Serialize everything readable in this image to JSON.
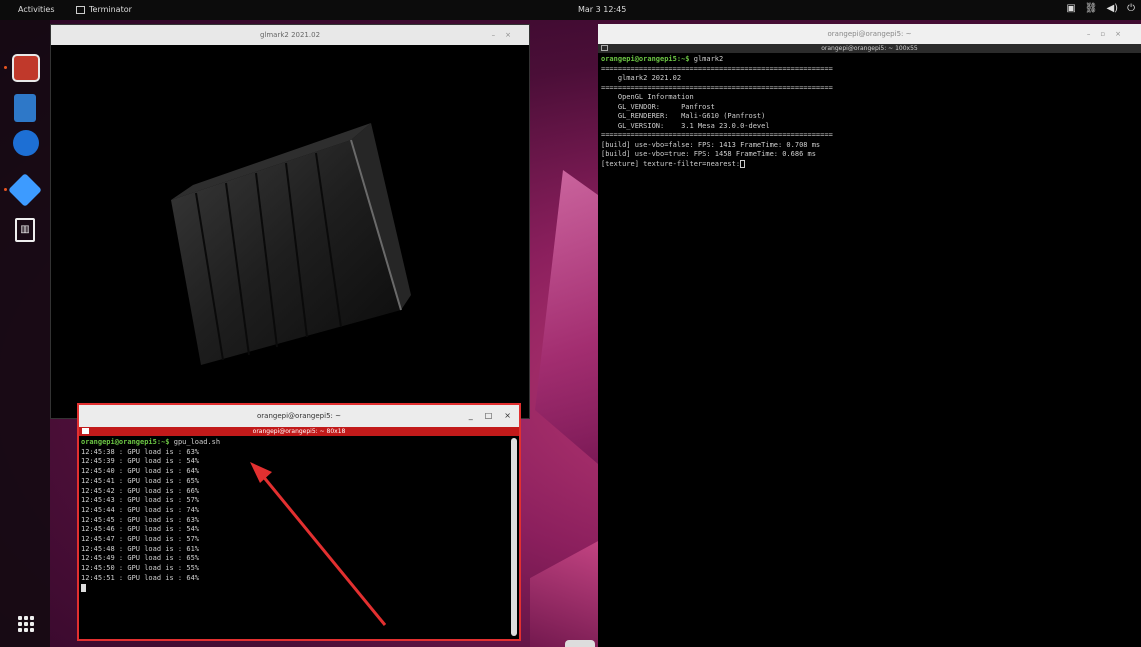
{
  "topbar": {
    "activities": "Activities",
    "app_name": "Terminator",
    "clock": "Mar 3  12:45",
    "tray_icons": [
      "screen-icon",
      "network-icon",
      "volume-icon",
      "power-icon"
    ]
  },
  "dock": {
    "items": [
      "terminator",
      "files",
      "thunderbird",
      "vscode",
      "trash"
    ],
    "show_apps": "show-apps-grid"
  },
  "glmark_window": {
    "title": "glmark2 2021.02"
  },
  "terminal_right": {
    "title": "orangepi@orangepi5: ~",
    "subtitle": "orangepi@orangepi5: ~ 100x55",
    "prompt": "orangepi@orangepi5:~$",
    "command": " glmark2",
    "lines": [
      "=======================================================",
      "    glmark2 2021.02",
      "=======================================================",
      "    OpenGL Information",
      "    GL_VENDOR:     Panfrost",
      "    GL_RENDERER:   Mali-G610 (Panfrost)",
      "    GL_VERSION:    3.1 Mesa 23.0.0-devel",
      "=======================================================",
      "[build] use-vbo=false: FPS: 1413 FrameTime: 0.708 ms",
      "[build] use-vbo=true: FPS: 1458 FrameTime: 0.686 ms",
      "[texture] texture-filter=nearest:"
    ]
  },
  "terminal_small": {
    "title": "orangepi@orangepi5: ~",
    "subtitle": "orangepi@orangepi5: ~ 80x18",
    "prompt": "orangepi@orangepi5:~$",
    "command": " gpu_load.sh",
    "lines": [
      "12:45:38 : GPU load is : 63%",
      "12:45:39 : GPU load is : 54%",
      "12:45:40 : GPU load is : 64%",
      "12:45:41 : GPU load is : 65%",
      "12:45:42 : GPU load is : 66%",
      "12:45:43 : GPU load is : 57%",
      "12:45:44 : GPU load is : 74%",
      "12:45:45 : GPU load is : 63%",
      "12:45:46 : GPU load is : 54%",
      "12:45:47 : GPU load is : 57%",
      "12:45:48 : GPU load is : 61%",
      "12:45:49 : GPU load is : 65%",
      "12:45:50 : GPU load is : 55%",
      "12:45:51 : GPU load is : 64%"
    ]
  },
  "colors": {
    "highlight_border": "#e23030",
    "prompt_green": "#6cc644",
    "terminator_active": "#c21a1a"
  }
}
